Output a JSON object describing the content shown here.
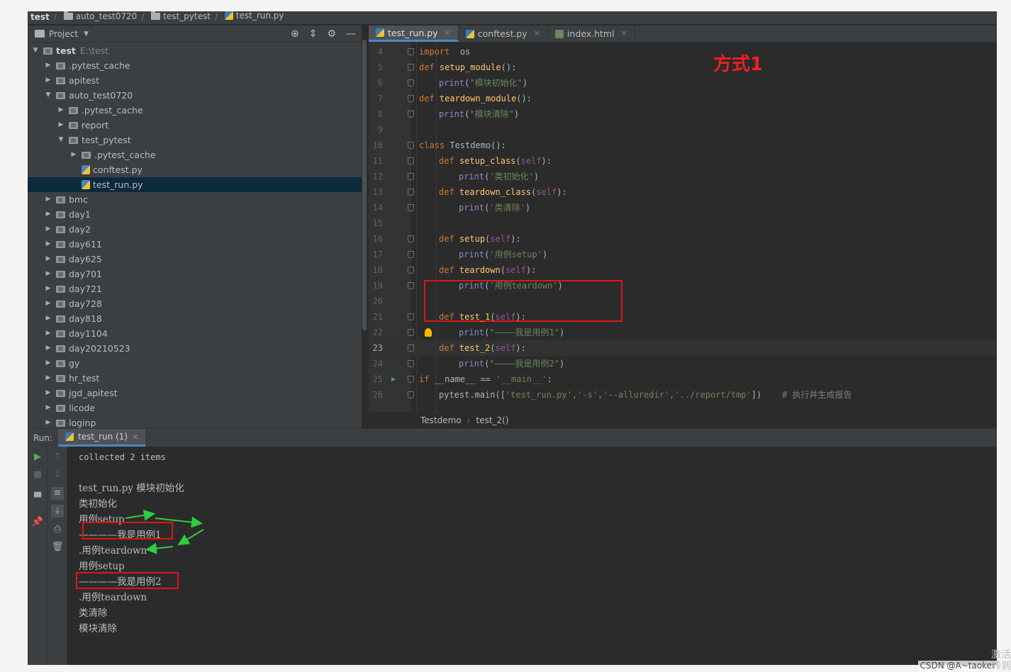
{
  "breadcrumb": [
    "test",
    "auto_test0720",
    "test_pytest",
    "test_run.py"
  ],
  "project": {
    "title": "Project",
    "tree": [
      {
        "label": "test",
        "path": "E:\\test",
        "level": 0,
        "expanded": true,
        "type": "folder"
      },
      {
        "label": ".pytest_cache",
        "level": 1,
        "expanded": false,
        "type": "folder"
      },
      {
        "label": "apitest",
        "level": 1,
        "expanded": false,
        "type": "folder"
      },
      {
        "label": "auto_test0720",
        "level": 1,
        "expanded": true,
        "type": "folder"
      },
      {
        "label": ".pytest_cache",
        "level": 2,
        "expanded": false,
        "type": "folder"
      },
      {
        "label": "report",
        "level": 2,
        "expanded": false,
        "type": "folder"
      },
      {
        "label": "test_pytest",
        "level": 2,
        "expanded": true,
        "type": "folder"
      },
      {
        "label": ".pytest_cache",
        "level": 3,
        "expanded": false,
        "type": "folder"
      },
      {
        "label": "conftest.py",
        "level": 3,
        "type": "file"
      },
      {
        "label": "test_run.py",
        "level": 3,
        "type": "file",
        "selected": true
      },
      {
        "label": "bmc",
        "level": 1,
        "expanded": false,
        "type": "folder"
      },
      {
        "label": "day1",
        "level": 1,
        "expanded": false,
        "type": "folder"
      },
      {
        "label": "day2",
        "level": 1,
        "expanded": false,
        "type": "folder"
      },
      {
        "label": "day611",
        "level": 1,
        "expanded": false,
        "type": "folder"
      },
      {
        "label": "day625",
        "level": 1,
        "expanded": false,
        "type": "folder"
      },
      {
        "label": "day701",
        "level": 1,
        "expanded": false,
        "type": "folder"
      },
      {
        "label": "day721",
        "level": 1,
        "expanded": false,
        "type": "folder"
      },
      {
        "label": "day728",
        "level": 1,
        "expanded": false,
        "type": "folder"
      },
      {
        "label": "day818",
        "level": 1,
        "expanded": false,
        "type": "folder"
      },
      {
        "label": "day1104",
        "level": 1,
        "expanded": false,
        "type": "folder"
      },
      {
        "label": "day20210523",
        "level": 1,
        "expanded": false,
        "type": "folder"
      },
      {
        "label": "gy",
        "level": 1,
        "expanded": false,
        "type": "folder"
      },
      {
        "label": "hr_test",
        "level": 1,
        "expanded": false,
        "type": "folder"
      },
      {
        "label": "jgd_apitest",
        "level": 1,
        "expanded": false,
        "type": "folder"
      },
      {
        "label": "licode",
        "level": 1,
        "expanded": false,
        "type": "folder"
      },
      {
        "label": "loginp",
        "level": 1,
        "expanded": false,
        "type": "folder"
      }
    ]
  },
  "editor": {
    "tabs": [
      {
        "label": "test_run.py",
        "active": true,
        "icon": "python-file-icon"
      },
      {
        "label": "conftest.py",
        "active": false,
        "icon": "python-file-icon"
      },
      {
        "label": "index.html",
        "active": false,
        "icon": "html-file-icon"
      }
    ],
    "annotation": "方式1",
    "current_line": 23,
    "lines": [
      {
        "n": 4,
        "indent": 0,
        "tokens": [
          [
            "kw",
            "import"
          ],
          [
            "",
            "  "
          ],
          [
            "",
            "os"
          ]
        ]
      },
      {
        "n": 5,
        "indent": 0,
        "tokens": [
          [
            "kw",
            "def"
          ],
          [
            "",
            " "
          ],
          [
            "fn",
            "setup_module"
          ],
          [
            "",
            "():"
          ]
        ]
      },
      {
        "n": 6,
        "indent": 1,
        "tokens": [
          [
            "bi",
            "print"
          ],
          [
            "",
            "("
          ],
          [
            "str",
            "\"模块初始化\""
          ],
          [
            "",
            ")"
          ]
        ]
      },
      {
        "n": 7,
        "indent": 0,
        "tokens": [
          [
            "kw",
            "def"
          ],
          [
            "",
            " "
          ],
          [
            "fn",
            "teardown_module"
          ],
          [
            "",
            "():"
          ]
        ]
      },
      {
        "n": 8,
        "indent": 1,
        "tokens": [
          [
            "bi",
            "print"
          ],
          [
            "",
            "("
          ],
          [
            "str",
            "\"模块清除\""
          ],
          [
            "",
            ")"
          ]
        ]
      },
      {
        "n": 9,
        "indent": 0,
        "tokens": []
      },
      {
        "n": 10,
        "indent": 0,
        "tokens": [
          [
            "kw",
            "class"
          ],
          [
            "",
            " Testdemo():"
          ]
        ]
      },
      {
        "n": 11,
        "indent": 1,
        "tokens": [
          [
            "kw",
            "def"
          ],
          [
            "",
            " "
          ],
          [
            "fn",
            "setup_class"
          ],
          [
            "",
            "("
          ],
          [
            "self",
            "self"
          ],
          [
            "",
            "):"
          ]
        ]
      },
      {
        "n": 12,
        "indent": 2,
        "tokens": [
          [
            "bi",
            "print"
          ],
          [
            "",
            "("
          ],
          [
            "str",
            "'类初始化'"
          ],
          [
            "",
            ")"
          ]
        ]
      },
      {
        "n": 13,
        "indent": 1,
        "tokens": [
          [
            "kw",
            "def"
          ],
          [
            "",
            " "
          ],
          [
            "fn",
            "teardown_class"
          ],
          [
            "",
            "("
          ],
          [
            "self",
            "self"
          ],
          [
            "",
            "):"
          ]
        ]
      },
      {
        "n": 14,
        "indent": 2,
        "tokens": [
          [
            "bi",
            "print"
          ],
          [
            "",
            "("
          ],
          [
            "str",
            "'类清除'"
          ],
          [
            "",
            ")"
          ]
        ]
      },
      {
        "n": 15,
        "indent": 0,
        "tokens": []
      },
      {
        "n": 16,
        "indent": 1,
        "tokens": [
          [
            "kw",
            "def"
          ],
          [
            "",
            " "
          ],
          [
            "fn",
            "setup"
          ],
          [
            "",
            "("
          ],
          [
            "self",
            "self"
          ],
          [
            "",
            "):"
          ]
        ]
      },
      {
        "n": 17,
        "indent": 2,
        "tokens": [
          [
            "bi",
            "print"
          ],
          [
            "",
            "("
          ],
          [
            "str",
            "'用例setup'"
          ],
          [
            "",
            ")"
          ]
        ]
      },
      {
        "n": 18,
        "indent": 1,
        "tokens": [
          [
            "kw",
            "def"
          ],
          [
            "",
            " "
          ],
          [
            "fn",
            "teardown"
          ],
          [
            "",
            "("
          ],
          [
            "self",
            "self"
          ],
          [
            "",
            "):"
          ]
        ]
      },
      {
        "n": 19,
        "indent": 2,
        "tokens": [
          [
            "bi",
            "print"
          ],
          [
            "",
            "("
          ],
          [
            "str",
            "'用例teardown'"
          ],
          [
            "",
            ")"
          ]
        ]
      },
      {
        "n": 20,
        "indent": 0,
        "tokens": []
      },
      {
        "n": 21,
        "indent": 1,
        "tokens": [
          [
            "kw",
            "def"
          ],
          [
            "",
            " "
          ],
          [
            "fn",
            "test_1"
          ],
          [
            "",
            "("
          ],
          [
            "self",
            "self"
          ],
          [
            "",
            "):"
          ]
        ]
      },
      {
        "n": 22,
        "indent": 2,
        "tokens": [
          [
            "bi",
            "print"
          ],
          [
            "",
            "("
          ],
          [
            "str",
            "\"————我是用例1\""
          ],
          [
            "",
            ")"
          ]
        ]
      },
      {
        "n": 23,
        "indent": 1,
        "tokens": [
          [
            "kw",
            "def"
          ],
          [
            "",
            " "
          ],
          [
            "fn",
            "test_2"
          ],
          [
            "",
            "("
          ],
          [
            "self",
            "self"
          ],
          [
            "",
            "):"
          ]
        ]
      },
      {
        "n": 24,
        "indent": 2,
        "tokens": [
          [
            "bi",
            "print"
          ],
          [
            "",
            "("
          ],
          [
            "str",
            "\"————我是用例2\""
          ],
          [
            "",
            ")"
          ]
        ]
      },
      {
        "n": 25,
        "indent": 0,
        "tokens": [
          [
            "kw",
            "if"
          ],
          [
            "",
            " __name__ == "
          ],
          [
            "str",
            "'__main__'"
          ],
          [
            "",
            ":"
          ]
        ]
      },
      {
        "n": 26,
        "indent": 1,
        "tokens": [
          [
            "",
            "pytest.main(["
          ],
          [
            "str",
            "'test_run.py'"
          ],
          [
            "kw",
            ","
          ],
          [
            "str",
            "'-s'"
          ],
          [
            "kw",
            ","
          ],
          [
            "str",
            "'--alluredir'"
          ],
          [
            "kw",
            ","
          ],
          [
            "str",
            "'../report/tmp'"
          ],
          [
            "",
            "])"
          ],
          [
            "",
            "    "
          ],
          [
            "cmt",
            "# 执行并生成报告"
          ]
        ]
      }
    ],
    "path_crumbs": [
      "Testdemo",
      "test_2()"
    ]
  },
  "run": {
    "label": "Run:",
    "tab": "test_run (1)",
    "output": [
      "collected 2 items",
      "",
      "test_run.py 模块初始化",
      "类初始化",
      "用例setup",
      "————我是用例1",
      ".用例teardown",
      "用例setup",
      "————我是用例2",
      ".用例teardown",
      "类清除",
      "模块清除"
    ]
  },
  "watermark": "CSDN @A~taoker",
  "corner_text": [
    "激活",
    "转到"
  ],
  "colors": {
    "annotation_red": "#e01515",
    "arrow_green": "#2ecc40",
    "accent_blue": "#4a88c7"
  }
}
